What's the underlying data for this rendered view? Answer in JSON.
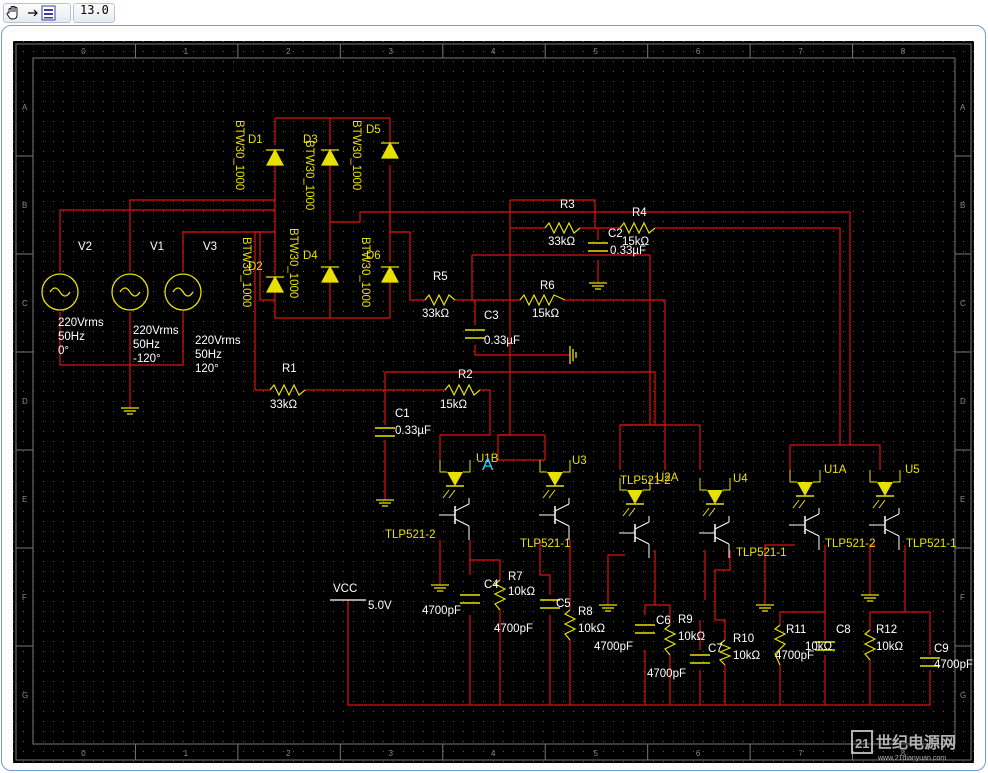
{
  "toolbar": {
    "hand_icon": "hand-icon",
    "arrow_icon": "arrow-right-icon",
    "doc_icon": "document-icon",
    "value": "13.0"
  },
  "grid": {
    "columns": [
      "0",
      "1",
      "2",
      "3",
      "4",
      "5",
      "6",
      "7",
      "8"
    ],
    "rows": [
      "A",
      "B",
      "C",
      "D",
      "E",
      "F",
      "G"
    ]
  },
  "sources": {
    "v2": {
      "name": "V2",
      "amp": "220Vrms",
      "freq": "50Hz",
      "phase": "0°"
    },
    "v1": {
      "name": "V1",
      "amp": "220Vrms",
      "freq": "50Hz",
      "phase": "-120°"
    },
    "v3": {
      "name": "V3",
      "amp": "220Vrms",
      "freq": "50Hz",
      "phase": "120°"
    }
  },
  "diodes": {
    "d1": "D1",
    "d2": "D2",
    "d3": "D3",
    "d4": "D4",
    "d5": "D5",
    "d6": "D6",
    "model": "BTW30_1000"
  },
  "resistors": {
    "r1": {
      "name": "R1",
      "value": "33kΩ"
    },
    "r2": {
      "name": "R2",
      "value": "15kΩ"
    },
    "r3": {
      "name": "R3",
      "value": "33kΩ"
    },
    "r4": {
      "name": "R4",
      "value": "15kΩ"
    },
    "r5": {
      "name": "R5",
      "value": "33kΩ"
    },
    "r6": {
      "name": "R6",
      "value": "15kΩ"
    },
    "r7": {
      "name": "R7",
      "value": "10kΩ"
    },
    "r8": {
      "name": "R8",
      "value": "10kΩ"
    },
    "r9": {
      "name": "R9",
      "value": "10kΩ"
    },
    "r10": {
      "name": "R10",
      "value": "10kΩ"
    },
    "r11": {
      "name": "R11",
      "value": "10kΩ"
    },
    "r12": {
      "name": "R12",
      "value": "10kΩ"
    }
  },
  "capacitors": {
    "c1": {
      "name": "C1",
      "value": "0.33µF"
    },
    "c2": {
      "name": "C2",
      "value": "0.33µF"
    },
    "c3": {
      "name": "C3",
      "value": "0.33µF"
    },
    "c4": {
      "name": "C4",
      "value": "4700pF"
    },
    "c5": {
      "name": "C5",
      "value": "4700pF"
    },
    "c6": {
      "name": "C6",
      "value": "4700pF"
    },
    "c7": {
      "name": "C7",
      "value": "4700pF"
    },
    "c8": {
      "name": "C8",
      "value": "4700pF"
    },
    "c9": {
      "name": "C9",
      "value": "4700pF"
    }
  },
  "optos": {
    "u1b": "U1B",
    "u3": "U3",
    "u2a": "U2A",
    "u4": "U4",
    "u1a": "U1A",
    "u5": "U5",
    "tlp2": "TLP521-2",
    "tlp1": "TLP521-1"
  },
  "vcc": {
    "name": "VCC",
    "value": "5.0V"
  },
  "probe": "A",
  "watermark": {
    "brand": "世纪电源网",
    "url": "www.21dianyuan.com"
  },
  "colors": {
    "wire": "#e01010",
    "component": "#e8e000",
    "text": "#ffffff",
    "probe": "#28d0ff",
    "grid": "#6a6a6a"
  }
}
